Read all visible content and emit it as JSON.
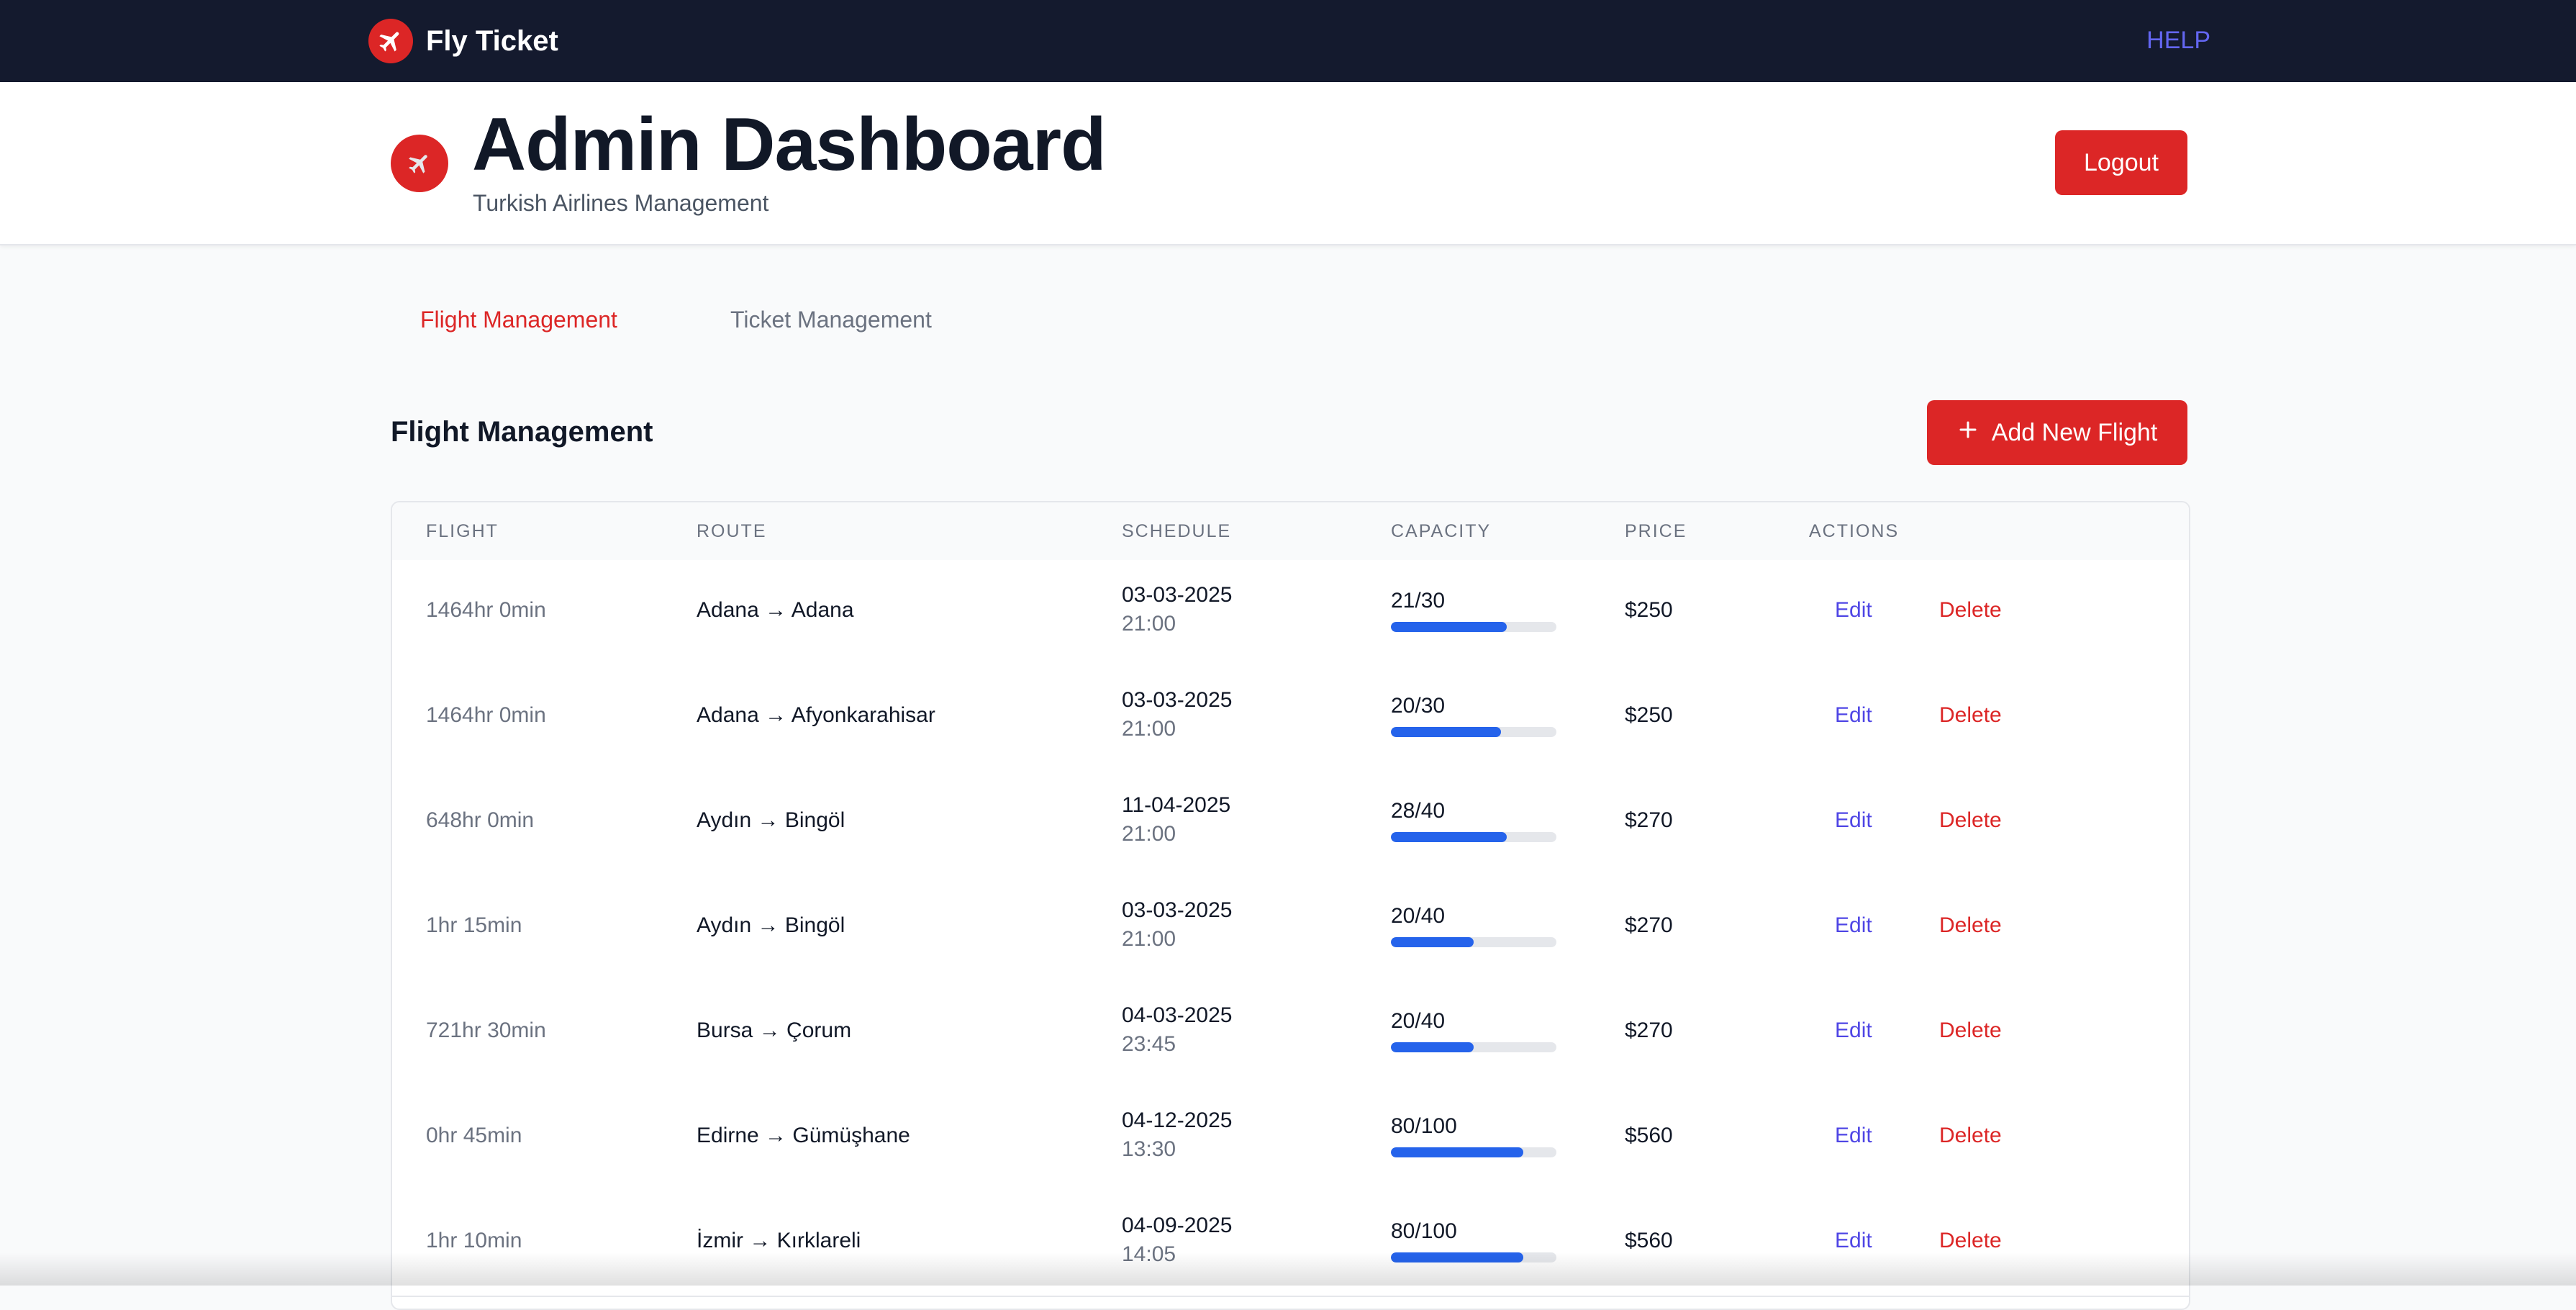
{
  "topnav": {
    "brand": "Fly Ticket",
    "help": "HELP",
    "brand_icon": "airplane-icon",
    "brand_color": "#dc2626"
  },
  "header": {
    "title": "Admin Dashboard",
    "subtitle": "Turkish Airlines Management",
    "logout": "Logout",
    "icon": "airplane-emoji-icon"
  },
  "tabs": [
    {
      "label": "Flight Management",
      "active": true
    },
    {
      "label": "Ticket Management",
      "active": false
    }
  ],
  "section": {
    "title": "Flight Management",
    "add_button": "Add New Flight"
  },
  "table": {
    "headers": [
      "FLIGHT",
      "ROUTE",
      "SCHEDULE",
      "CAPACITY",
      "PRICE",
      "ACTIONS"
    ],
    "rows": [
      {
        "duration": "1464hr 0min",
        "route": "Adana → Adana",
        "date": "03-03-2025",
        "time": "21:00",
        "capacity": "21/30",
        "fill": 0.7,
        "price": "$250",
        "edit": "Edit",
        "delete": "Delete"
      },
      {
        "duration": "1464hr 0min",
        "route": "Adana → Afyonkarahisar",
        "date": "03-03-2025",
        "time": "21:00",
        "capacity": "20/30",
        "fill": 0.667,
        "price": "$250",
        "edit": "Edit",
        "delete": "Delete"
      },
      {
        "duration": "648hr 0min",
        "route": "Aydın → Bingöl",
        "date": "11-04-2025",
        "time": "21:00",
        "capacity": "28/40",
        "fill": 0.7,
        "price": "$270",
        "edit": "Edit",
        "delete": "Delete"
      },
      {
        "duration": "1hr 15min",
        "route": "Aydın → Bingöl",
        "date": "03-03-2025",
        "time": "21:00",
        "capacity": "20/40",
        "fill": 0.5,
        "price": "$270",
        "edit": "Edit",
        "delete": "Delete"
      },
      {
        "duration": "721hr 30min",
        "route": "Bursa → Çorum",
        "date": "04-03-2025",
        "time": "23:45",
        "capacity": "20/40",
        "fill": 0.5,
        "price": "$270",
        "edit": "Edit",
        "delete": "Delete"
      },
      {
        "duration": "0hr 45min",
        "route": "Edirne → Gümüşhane",
        "date": "04-12-2025",
        "time": "13:30",
        "capacity": "80/100",
        "fill": 0.8,
        "price": "$560",
        "edit": "Edit",
        "delete": "Delete"
      },
      {
        "duration": "1hr 10min",
        "route": "İzmir → Kırklareli",
        "date": "04-09-2025",
        "time": "14:05",
        "capacity": "80/100",
        "fill": 0.8,
        "price": "$560",
        "edit": "Edit",
        "delete": "Delete"
      }
    ]
  }
}
